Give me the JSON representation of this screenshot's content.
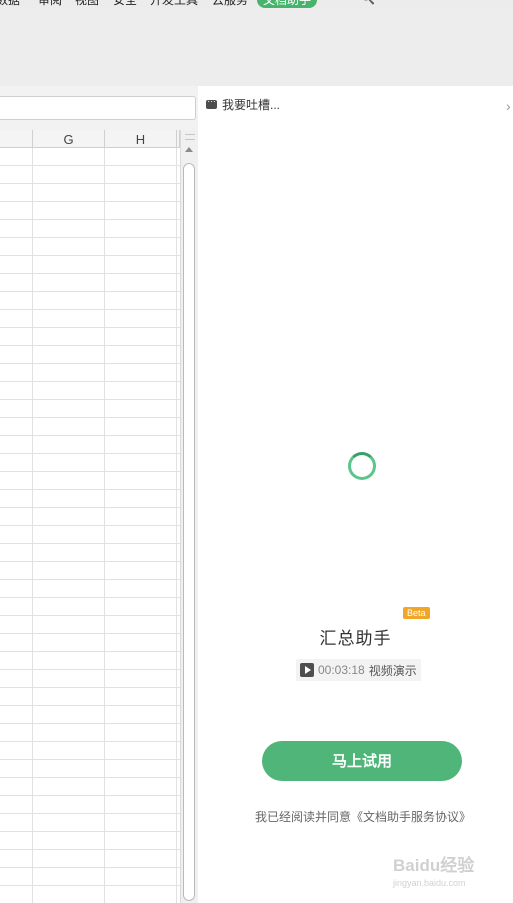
{
  "menu": {
    "items": [
      "数据",
      "审阅",
      "视图",
      "安全",
      "开发工具",
      "云服务",
      "文档助手"
    ],
    "active_index": 6
  },
  "sheet": {
    "columns": [
      "G",
      "H"
    ]
  },
  "panel": {
    "feedback_label": "我要吐槽...",
    "feature_title": "汇总助手",
    "beta_badge": "Beta",
    "video_time": "00:03:18",
    "video_label": "视频演示",
    "try_button": "马上试用",
    "agreement_text": "我已经阅读并同意《文档助手服务协议》",
    "accent_color": "#4fb579"
  },
  "watermark": {
    "brand": "Baidu经验",
    "url": "jingyan.baidu.com"
  }
}
